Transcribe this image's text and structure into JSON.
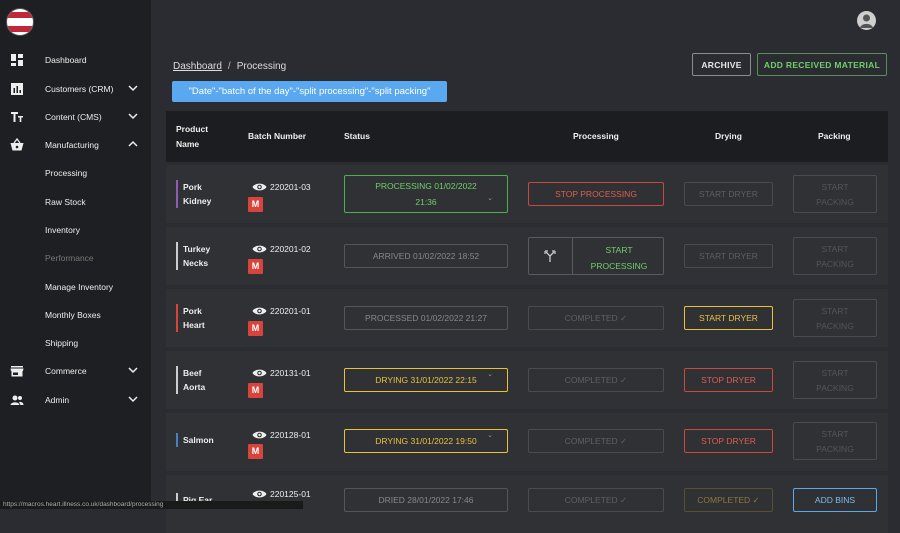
{
  "sidebar": {
    "items": [
      {
        "label": "Dashboard",
        "icon": "dashboard-icon"
      },
      {
        "label": "Customers (CRM)",
        "icon": "chart-icon",
        "expanded": false
      },
      {
        "label": "Content (CMS)",
        "icon": "text-icon",
        "expanded": false
      },
      {
        "label": "Manufacturing",
        "icon": "basket-icon",
        "expanded": true
      },
      {
        "label": "Processing"
      },
      {
        "label": "Raw Stock"
      },
      {
        "label": "Inventory"
      },
      {
        "label": "Performance"
      },
      {
        "label": "Manage Inventory"
      },
      {
        "label": "Monthly Boxes"
      },
      {
        "label": "Shipping"
      },
      {
        "label": "Commerce",
        "icon": "store-icon",
        "expanded": false
      },
      {
        "label": "Admin",
        "icon": "people-icon",
        "expanded": false
      }
    ]
  },
  "breadcrumb": {
    "root": "Dashboard",
    "sep": "/",
    "current": "Processing"
  },
  "filter_chip": "\"Date\"-\"batch of the day\"-\"split processing\"-\"split packing\"",
  "buttons": {
    "archive": "ARCHIVE",
    "add_received": "ADD RECEIVED MATERIAL"
  },
  "table": {
    "headers": {
      "product_l1": "Product",
      "product_l2": "Name",
      "batch": "Batch Number",
      "status": "Status",
      "processing": "Processing",
      "drying": "Drying",
      "packing": "Packing"
    },
    "rows": [
      {
        "name_l1": "Pork",
        "name_l2": "Kidney",
        "batch": "220201-03",
        "badge": "M",
        "status_l1": "PROCESSING 01/02/2022",
        "status_l2": "21:36",
        "processing": "STOP PROCESSING",
        "drying": "START DRYER",
        "pack_l1": "START",
        "pack_l2": "PACKING"
      },
      {
        "name_l1": "Turkey",
        "name_l2": "Necks",
        "batch": "220201-02",
        "badge": "M",
        "status": "ARRIVED 01/02/2022 18:52",
        "processing_l1": "START",
        "processing_l2": "PROCESSING",
        "drying": "START DRYER",
        "pack_l1": "START",
        "pack_l2": "PACKING"
      },
      {
        "name_l1": "Pork",
        "name_l2": "Heart",
        "batch": "220201-01",
        "badge": "M",
        "status": "PROCESSED 01/02/2022 21:27",
        "processing": "COMPLETED ✓",
        "drying": "START DRYER",
        "pack_l1": "START",
        "pack_l2": "PACKING"
      },
      {
        "name_l1": "Beef",
        "name_l2": "Aorta",
        "batch": "220131-01",
        "badge": "M",
        "status": "DRYING 31/01/2022 22:15",
        "processing": "COMPLETED ✓",
        "drying": "STOP DRYER",
        "pack_l1": "START",
        "pack_l2": "PACKING"
      },
      {
        "name_l1": "Salmon",
        "batch": "220128-01",
        "badge": "M",
        "status": "DRYING 31/01/2022 19:50",
        "processing": "COMPLETED ✓",
        "drying": "STOP DRYER",
        "pack_l1": "START",
        "pack_l2": "PACKING"
      },
      {
        "name_l1": "Pig Ear",
        "batch": "220125-01",
        "status": "DRIED 28/01/2022 17:46",
        "processing": "COMPLETED ✓",
        "drying": "COMPLETED ✓",
        "packing": "ADD BINS"
      }
    ]
  },
  "status_url": "https://macros.heart.illness.co.uk/dashboard/processing",
  "colors": {
    "accent_green": "#6fcf6a",
    "accent_red": "#e05c52",
    "accent_yellow": "#e8c23a",
    "accent_blue": "#5aa8f0",
    "brand_red": "#c0283a"
  }
}
